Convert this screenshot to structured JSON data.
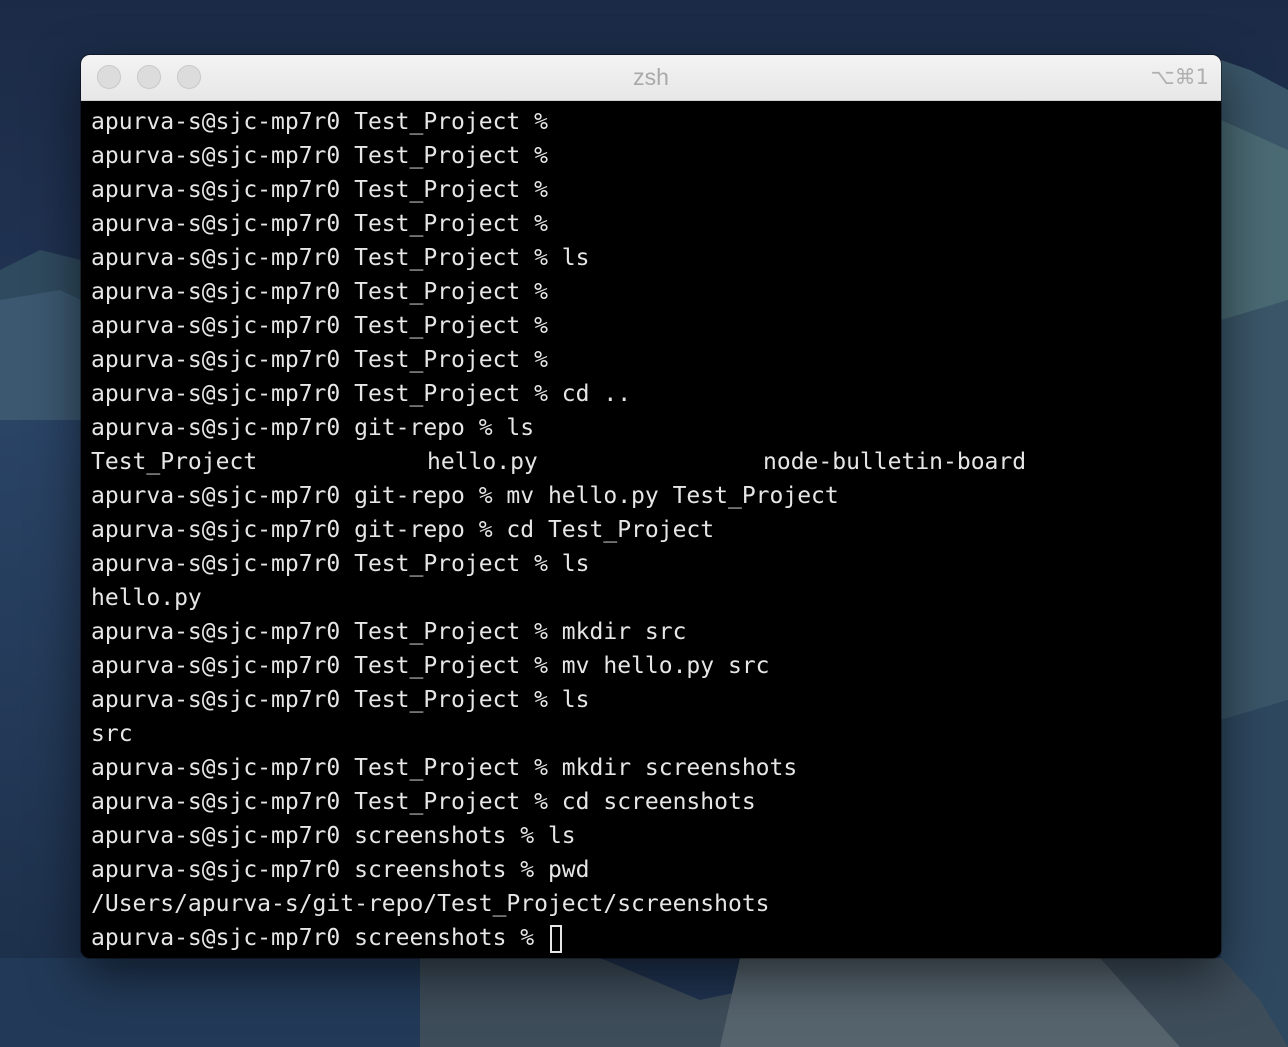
{
  "window": {
    "title": "zsh",
    "shortcut": "⌥⌘1"
  },
  "terminal": {
    "lines": [
      "apurva-s@sjc-mp7r0 Test_Project %",
      "apurva-s@sjc-mp7r0 Test_Project %",
      "apurva-s@sjc-mp7r0 Test_Project %",
      "apurva-s@sjc-mp7r0 Test_Project %",
      "apurva-s@sjc-mp7r0 Test_Project % ls",
      "apurva-s@sjc-mp7r0 Test_Project %",
      "apurva-s@sjc-mp7r0 Test_Project %",
      "apurva-s@sjc-mp7r0 Test_Project %",
      "apurva-s@sjc-mp7r0 Test_Project % cd ..",
      "apurva-s@sjc-mp7r0 git-repo % ls"
    ],
    "ls_output": [
      "Test_Project",
      "hello.py",
      "node-bulletin-board"
    ],
    "lines_after": [
      "apurva-s@sjc-mp7r0 git-repo % mv hello.py Test_Project",
      "apurva-s@sjc-mp7r0 git-repo % cd Test_Project",
      "apurva-s@sjc-mp7r0 Test_Project % ls",
      "hello.py",
      "apurva-s@sjc-mp7r0 Test_Project % mkdir src",
      "apurva-s@sjc-mp7r0 Test_Project % mv hello.py src",
      "apurva-s@sjc-mp7r0 Test_Project % ls",
      "src",
      "apurva-s@sjc-mp7r0 Test_Project % mkdir screenshots",
      "apurva-s@sjc-mp7r0 Test_Project % cd screenshots",
      "apurva-s@sjc-mp7r0 screenshots % ls",
      "apurva-s@sjc-mp7r0 screenshots % pwd",
      "/Users/apurva-s/git-repo/Test_Project/screenshots"
    ],
    "current_prompt": "apurva-s@sjc-mp7r0 screenshots % "
  }
}
